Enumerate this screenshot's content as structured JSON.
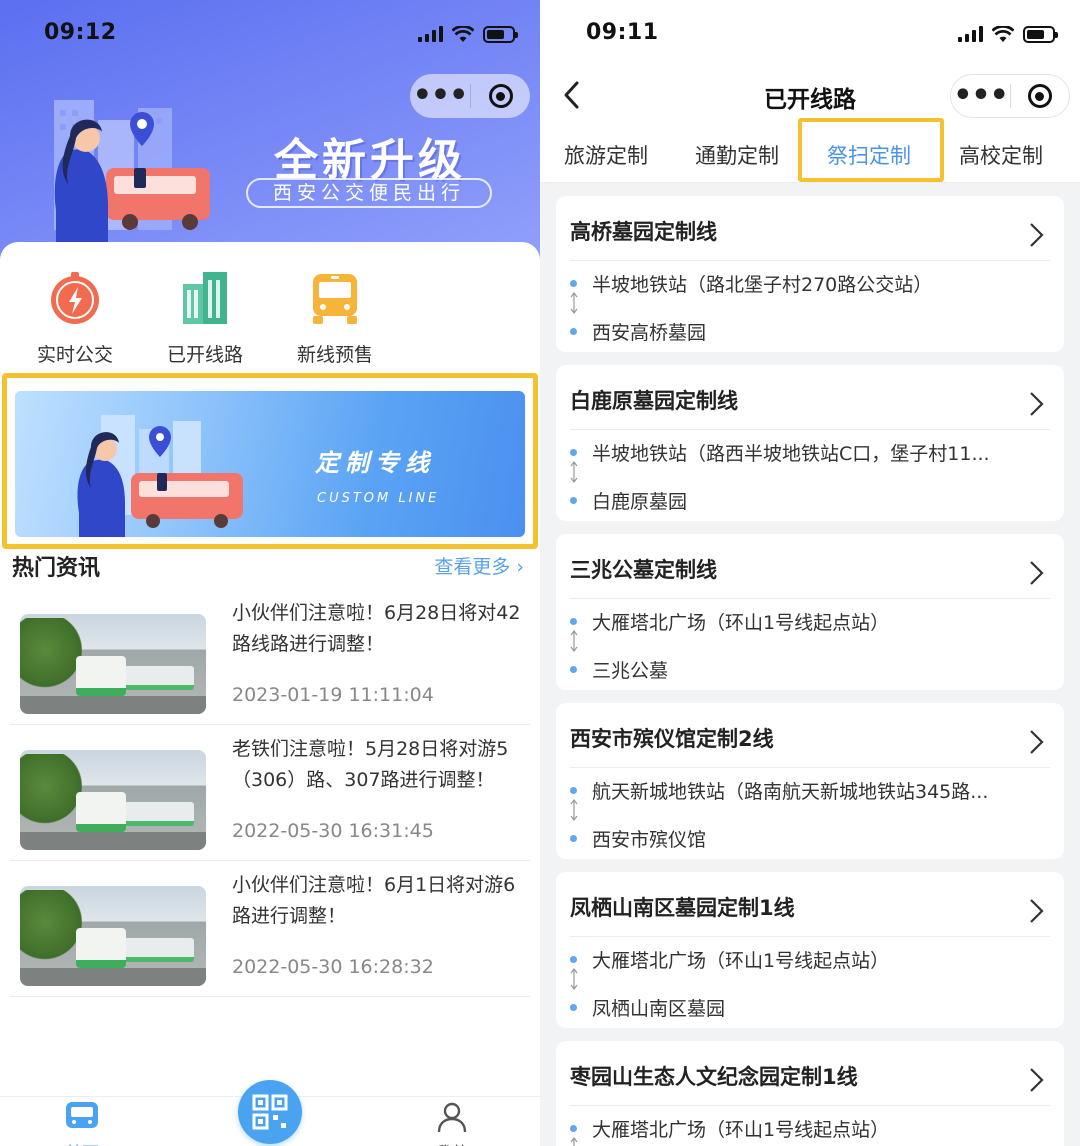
{
  "left": {
    "status": {
      "time": "09:12"
    },
    "hero": {
      "title": "全新升级",
      "subtitle": "西安公交便民出行"
    },
    "quick_actions": [
      {
        "label": "实时公交",
        "icon": "lightning-icon"
      },
      {
        "label": "已开线路",
        "icon": "building-icon"
      },
      {
        "label": "新线预售",
        "icon": "bus-icon"
      }
    ],
    "banner": {
      "title": "定制专线",
      "subtitle": "CUSTOM LINE"
    },
    "news_section": {
      "title": "热门资讯",
      "more_label": "查看更多"
    },
    "news": [
      {
        "title": "小伙伴们注意啦！6月28日将对42路线路进行调整！",
        "date": "2023-01-19 11:11:04"
      },
      {
        "title": "老铁们注意啦！5月28日将对游5（306）路、307路进行调整！",
        "date": "2022-05-30 16:31:45"
      },
      {
        "title": "小伙伴们注意啦！6月1日将对游6路进行调整！",
        "date": "2022-05-30 16:28:32"
      }
    ],
    "tabbar": {
      "home": "首页",
      "mine": "我的"
    }
  },
  "right": {
    "status": {
      "time": "09:11"
    },
    "nav_title": "已开线路",
    "tabs": [
      {
        "label": "旅游定制"
      },
      {
        "label": "通勤定制"
      },
      {
        "label": "祭扫定制",
        "active": true
      },
      {
        "label": "高校定制"
      }
    ],
    "routes": [
      {
        "name": "高桥墓园定制线",
        "from": "半坡地铁站（路北堡子村270路公交站）",
        "to": "西安高桥墓园"
      },
      {
        "name": "白鹿原墓园定制线",
        "from": "半坡地铁站（路西半坡地铁站C口，堡子村11...",
        "to": "白鹿原墓园"
      },
      {
        "name": "三兆公墓定制线",
        "from": "大雁塔北广场（环山1号线起点站）",
        "to": "三兆公墓"
      },
      {
        "name": "西安市殡仪馆定制2线",
        "from": "航天新城地铁站（路南航天新城地铁站345路...",
        "to": "西安市殡仪馆"
      },
      {
        "name": "凤栖山南区墓园定制1线",
        "from": "大雁塔北广场（环山1号线起点站）",
        "to": "凤栖山南区墓园"
      },
      {
        "name": "枣园山生态人文纪念园定制1线",
        "from": "大雁塔北广场（环山1号线起点站）",
        "to": ""
      }
    ]
  },
  "colors": {
    "accent_blue": "#4b93e8",
    "highlight_yellow": "#f5c12e",
    "hero_purple": "#6b7ff2"
  }
}
